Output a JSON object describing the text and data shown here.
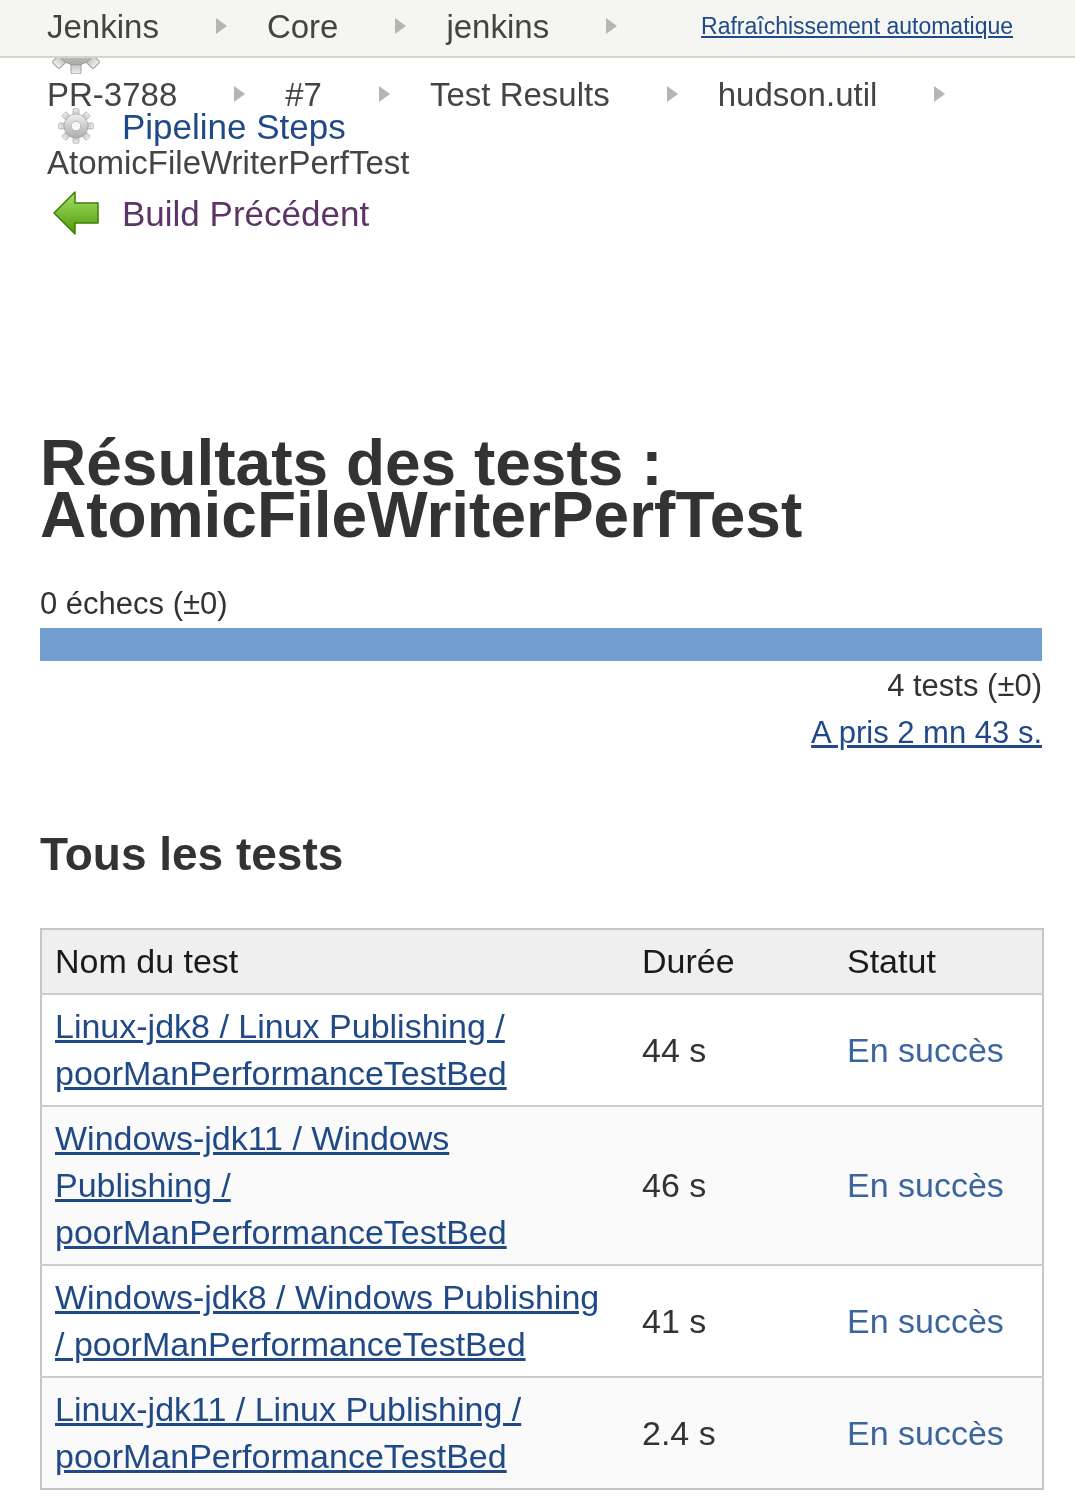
{
  "breadcrumbs": [
    "Jenkins",
    "Core",
    "jenkins",
    "PR-3788",
    "#7",
    "Test Results",
    "hudson.util",
    "AtomicFileWriterPerfTest"
  ],
  "auto_refresh_link": "Rafraîchissement automatique",
  "sidebar": {
    "items": [
      {
        "kind": "steps",
        "label": "Pipeline Steps",
        "visited": false
      },
      {
        "kind": "previous",
        "label": "Build Précédent",
        "visited": true
      }
    ]
  },
  "title": "Résultats des tests : AtomicFileWriterPerfTest",
  "summary": {
    "failures": "0 échecs (±0)",
    "bar": {
      "level": 1
    },
    "total": "4 tests (±0)",
    "duration_link": "A pris 2 mn 43 s."
  },
  "all_tests": {
    "heading": "Tous les tests",
    "table": {
      "columns": [
        "Nom du test",
        "Durée",
        "Statut"
      ],
      "rows": [
        {
          "name": "Linux-jdk8 / Linux Publishing / poorManPerformanceTestBed",
          "duration": "44 s",
          "status": "En succès",
          "passed": true
        },
        {
          "name": "Windows-jdk11 / Windows Publishing / poorManPerformanceTestBed",
          "duration": "46 s",
          "status": "En succès",
          "passed": true
        },
        {
          "name": "Windows-jdk8 / Windows Publishing / poorManPerformanceTestBed",
          "duration": "41 s",
          "status": "En succès",
          "passed": true
        },
        {
          "name": "Linux-jdk11 / Linux Publishing / poorManPerformanceTestBed",
          "duration": "2.4 s",
          "status": "En succès",
          "passed": true
        }
      ]
    }
  }
}
